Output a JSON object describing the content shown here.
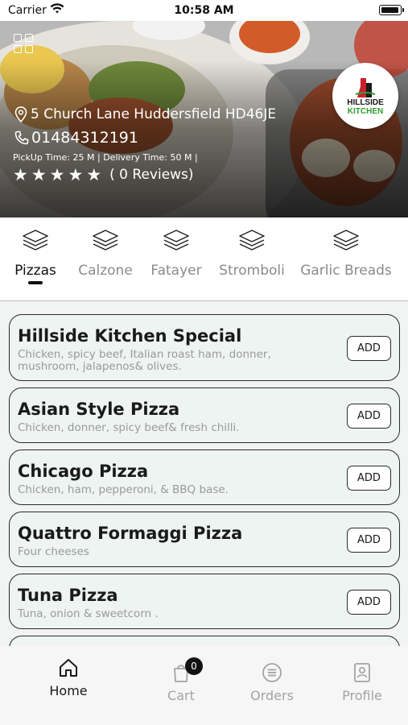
{
  "status_bar": {
    "carrier": "Carrier",
    "time": "10:58 AM"
  },
  "restaurant": {
    "logo_text_line1": "HILLSIDE",
    "logo_text_line2": "KITCHEN",
    "address": "5 Church Lane Huddersfield HD46JE",
    "phone": "01484312191",
    "times": "PickUp Time: 25 M | Delivery Time: 50 M |",
    "rating_stars": 5,
    "reviews": "( 0 Reviews)"
  },
  "categories": [
    {
      "label": "Pizzas",
      "active": true
    },
    {
      "label": "Calzone",
      "active": false
    },
    {
      "label": "Fatayer",
      "active": false
    },
    {
      "label": "Stromboli",
      "active": false
    },
    {
      "label": "Garlic Breads",
      "active": false
    }
  ],
  "items": [
    {
      "title": "Hillside Kitchen Special",
      "desc": "Chicken, spicy beef, Italian roast ham, donner, mushroom, jalapenos& olives.",
      "action": "ADD"
    },
    {
      "title": "Asian Style Pizza",
      "desc": "Chicken, donner, spicy beef& fresh chilli.",
      "action": "ADD"
    },
    {
      "title": "Chicago Pizza",
      "desc": "Chicken, ham, pepperoni, & BBQ base.",
      "action": "ADD"
    },
    {
      "title": "Quattro Formaggi Pizza",
      "desc": "Four cheeses",
      "action": "ADD"
    },
    {
      "title": "Tuna Pizza",
      "desc": "Tuna, onion & sweetcorn .",
      "action": "ADD"
    }
  ],
  "tabs": [
    {
      "label": "Home",
      "icon": "home-icon",
      "active": true
    },
    {
      "label": "Cart",
      "icon": "cart-icon",
      "active": false,
      "badge": "0"
    },
    {
      "label": "Orders",
      "icon": "orders-icon",
      "active": false
    },
    {
      "label": "Profile",
      "icon": "profile-icon",
      "active": false
    }
  ],
  "colors": {
    "card_bg": "#eef4f1",
    "logo_green": "#2e9e2e",
    "logo_red": "#c8232c"
  }
}
